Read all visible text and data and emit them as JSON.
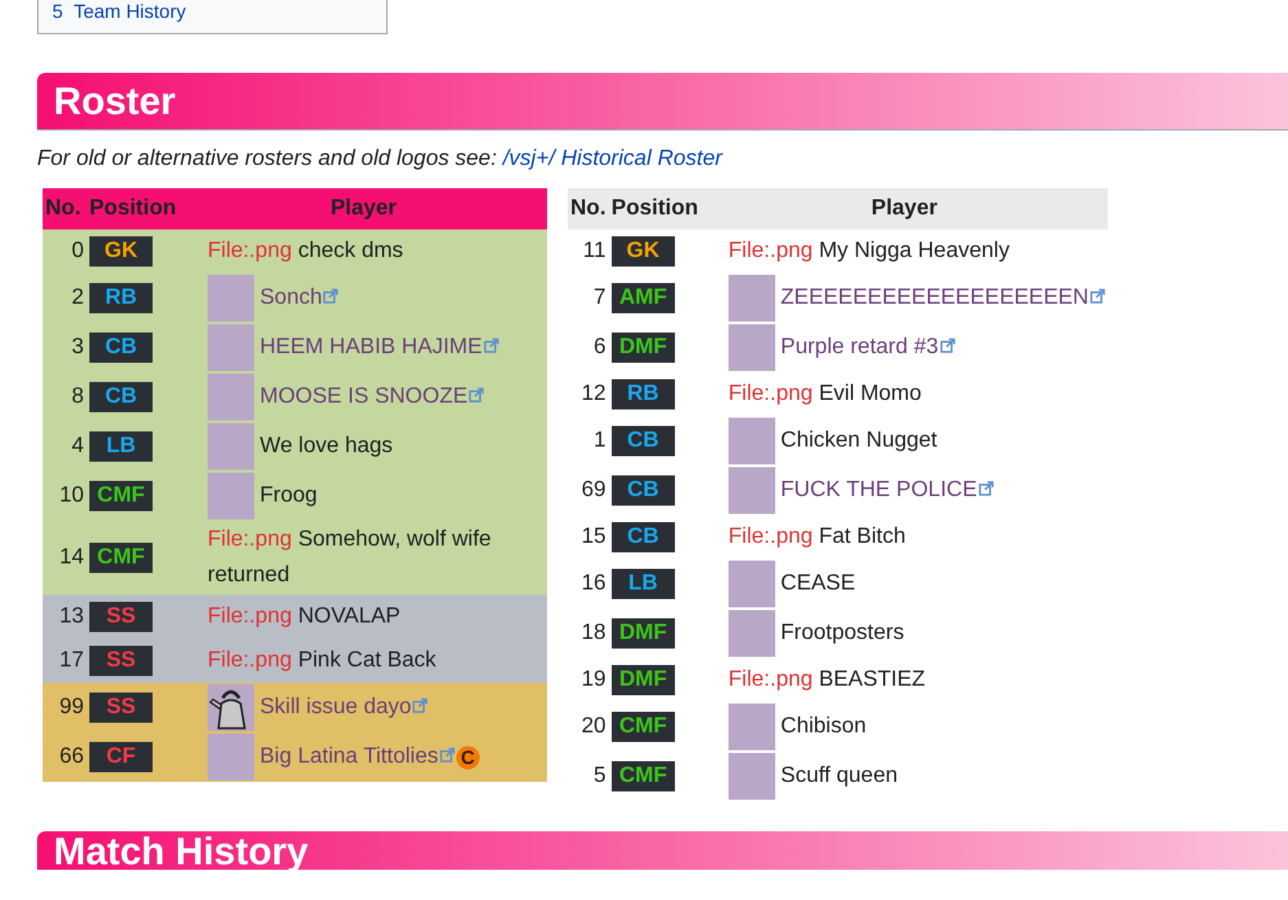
{
  "toc": {
    "items": [
      {
        "number": "5",
        "label": "Team History"
      }
    ]
  },
  "roster": {
    "heading": "Roster",
    "note": "For old or alternative rosters and old logos see: ",
    "note_link": "/vsj+/ Historical Roster",
    "tables": [
      {
        "color": "#f50f72",
        "columns": [
          "No.",
          "Position",
          "Player"
        ],
        "rows": [
          {
            "no": "0",
            "position": {
              "label": "GK",
              "kind": "goalkeeper"
            },
            "color": "#c4d79e",
            "kind": "missing_image",
            "file": "File:.png",
            "name": "check dms"
          },
          {
            "no": "2",
            "position": {
              "label": "RB",
              "kind": "defender"
            },
            "color": "#c4d79e",
            "kind": "avatar",
            "name": "Sonch",
            "link": true
          },
          {
            "no": "3",
            "position": {
              "label": "CB",
              "kind": "defender"
            },
            "color": "#c4d79e",
            "kind": "avatar",
            "name": "HEEM HABIB HAJIME",
            "link": true
          },
          {
            "no": "8",
            "position": {
              "label": "CB",
              "kind": "defender"
            },
            "color": "#c4d79e",
            "kind": "avatar",
            "name": "MOOSE IS SNOOZE",
            "link": true
          },
          {
            "no": "4",
            "position": {
              "label": "LB",
              "kind": "defender"
            },
            "color": "#c4d79e",
            "kind": "avatar",
            "name": "We love hags",
            "link": false
          },
          {
            "no": "10",
            "position": {
              "label": "CMF",
              "kind": "midfielder"
            },
            "color": "#c4d79e",
            "kind": "avatar",
            "name": "Froog",
            "link": false
          },
          {
            "no": "14",
            "position": {
              "label": "CMF",
              "kind": "midfielder"
            },
            "color": "#c4d79e",
            "kind": "missing_image",
            "file": "File:.png",
            "name": "Somehow, wolf wife returned"
          },
          {
            "no": "13",
            "position": {
              "label": "SS",
              "kind": "forward"
            },
            "color": "#b9bec6",
            "kind": "missing_image",
            "file": "File:.png",
            "name": "NOVALAP"
          },
          {
            "no": "17",
            "position": {
              "label": "SS",
              "kind": "forward"
            },
            "color": "#b9bec6",
            "kind": "missing_image",
            "file": "File:.png",
            "name": "Pink Cat Back"
          },
          {
            "no": "99",
            "position": {
              "label": "SS",
              "kind": "forward"
            },
            "color": "#e0bf67",
            "kind": "kettle",
            "name": "Skill issue dayo",
            "link": true
          },
          {
            "no": "66",
            "position": {
              "label": "CF",
              "kind": "forward"
            },
            "color": "#e0bf67",
            "kind": "avatar",
            "name": "Big Latina Tittolies",
            "link": true,
            "badge": "C"
          }
        ]
      },
      {
        "color": "#eaeaea",
        "columns": [
          "No.",
          "Position",
          "Player"
        ],
        "rows": [
          {
            "no": "11",
            "position": {
              "label": "GK",
              "kind": "goalkeeper"
            },
            "kind": "missing_image",
            "file": "File:.png",
            "name": "My Nigga Heavenly"
          },
          {
            "no": "7",
            "position": {
              "label": "AMF",
              "kind": "midfielder"
            },
            "kind": "avatar",
            "name": "ZEEEEEEEEEEEEEEEEEEEN",
            "link": true
          },
          {
            "no": "6",
            "position": {
              "label": "DMF",
              "kind": "midfielder"
            },
            "kind": "avatar",
            "name": "Purple retard #3",
            "link": true
          },
          {
            "no": "12",
            "position": {
              "label": "RB",
              "kind": "defender"
            },
            "kind": "missing_image",
            "file": "File:.png",
            "name": "Evil Momo"
          },
          {
            "no": "1",
            "position": {
              "label": "CB",
              "kind": "defender"
            },
            "kind": "avatar",
            "name": "Chicken Nugget",
            "link": false
          },
          {
            "no": "69",
            "position": {
              "label": "CB",
              "kind": "defender"
            },
            "kind": "avatar",
            "name": "FUCK THE POLICE",
            "link": true
          },
          {
            "no": "15",
            "position": {
              "label": "CB",
              "kind": "defender"
            },
            "kind": "missing_image",
            "file": "File:.png",
            "name": "Fat Bitch"
          },
          {
            "no": "16",
            "position": {
              "label": "LB",
              "kind": "defender"
            },
            "kind": "avatar",
            "name": "CEASE",
            "link": false
          },
          {
            "no": "18",
            "position": {
              "label": "DMF",
              "kind": "midfielder"
            },
            "kind": "avatar",
            "name": "Frootposters",
            "link": false
          },
          {
            "no": "19",
            "position": {
              "label": "DMF",
              "kind": "midfielder"
            },
            "kind": "missing_image",
            "file": "File:.png",
            "name": "BEASTIEZ"
          },
          {
            "no": "20",
            "position": {
              "label": "CMF",
              "kind": "midfielder"
            },
            "kind": "avatar",
            "name": "Chibison",
            "link": false
          },
          {
            "no": "5",
            "position": {
              "label": "CMF",
              "kind": "midfielder"
            },
            "kind": "avatar",
            "name": "Scuff queen",
            "link": false
          }
        ]
      }
    ]
  },
  "match_history": {
    "heading": "Match History"
  }
}
